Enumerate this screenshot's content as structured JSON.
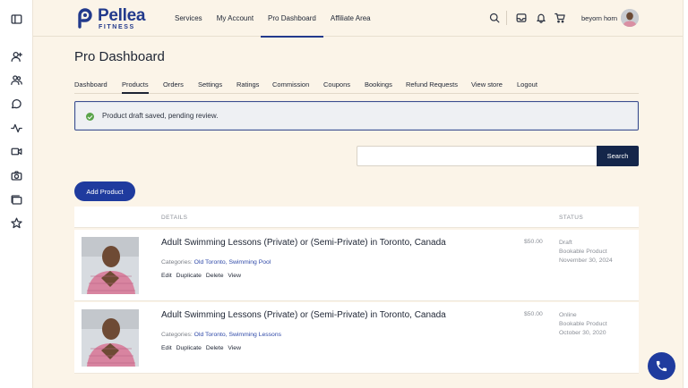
{
  "sidebar": {
    "icons": [
      "panel-toggle-icon",
      "user-plus-icon",
      "users-icon",
      "chat-icon",
      "activity-icon",
      "video-icon",
      "camera-icon",
      "folder-icon",
      "star-icon"
    ]
  },
  "brand": {
    "name": "Pellea",
    "sub": "FITNESS",
    "color": "#223a8c"
  },
  "nav": {
    "items": [
      {
        "label": "Services"
      },
      {
        "label": "My Account"
      },
      {
        "label": "Pro Dashboard",
        "active": true
      },
      {
        "label": "Affiliate Area"
      }
    ]
  },
  "header": {
    "user_name": "beyorn horn"
  },
  "page": {
    "title": "Pro Dashboard"
  },
  "tabs": [
    {
      "label": "Dashboard"
    },
    {
      "label": "Products",
      "active": true
    },
    {
      "label": "Orders"
    },
    {
      "label": "Settings"
    },
    {
      "label": "Ratings"
    },
    {
      "label": "Commission"
    },
    {
      "label": "Coupons"
    },
    {
      "label": "Bookings"
    },
    {
      "label": "Refund Requests"
    },
    {
      "label": "View store"
    },
    {
      "label": "Logout"
    }
  ],
  "notice": {
    "message": "Product draft saved, pending review."
  },
  "search": {
    "value": "",
    "button_label": "Search"
  },
  "add_product_label": "Add Product",
  "table": {
    "headers": {
      "details": "DETAILS",
      "status": "STATUS"
    },
    "rows": [
      {
        "name": "Adult Swimming Lessons (Private) or (Semi-Private) in Toronto, Canada",
        "categories_label": "Categories:",
        "categories": [
          "Old Toronto",
          "Swimming Pool"
        ],
        "actions": [
          "Edit",
          "Duplicate",
          "Delete",
          "View"
        ],
        "price": "$50.00",
        "status": "Draft",
        "type": "Bookable Product",
        "date": "November 30, 2024"
      },
      {
        "name": "Adult Swimming Lessons (Private) or (Semi-Private) in Toronto, Canada",
        "categories_label": "Categories:",
        "categories": [
          "Old Toronto",
          "Swimming Lessons"
        ],
        "actions": [
          "Edit",
          "Duplicate",
          "Delete",
          "View"
        ],
        "price": "$50.00",
        "status": "Online",
        "type": "Bookable Product",
        "date": "October 30, 2020"
      }
    ]
  },
  "colors": {
    "accent": "#1f3b9e",
    "background": "#fbf4e8",
    "dark_button": "#14264a",
    "success": "#5aa44a"
  }
}
